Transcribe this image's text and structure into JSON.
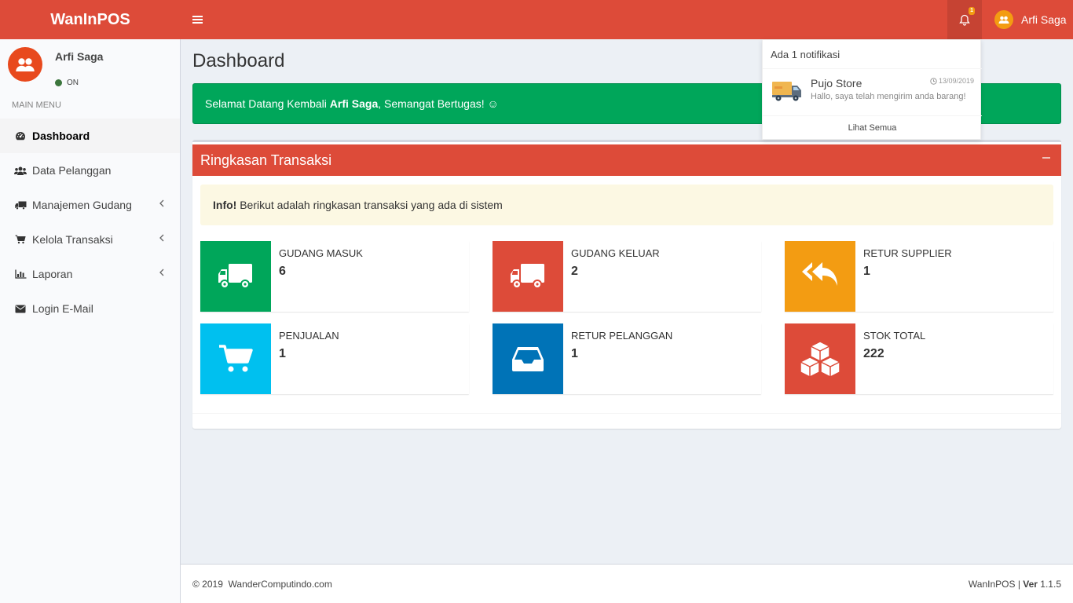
{
  "app": {
    "logo": "WanInPOS"
  },
  "header": {
    "notification_badge": "1",
    "user_name": "Arfi Saga"
  },
  "notifications": {
    "header": "Ada 1 notifikasi",
    "items": [
      {
        "from": "Pujo Store",
        "time": "13/09/2019",
        "message": "Hallo, saya telah mengirim anda barang!"
      }
    ],
    "footer": "Lihat Semua"
  },
  "sidebar": {
    "user_name": "Arfi Saga",
    "status": "ON",
    "menu_header": "MAIN MENU",
    "items": [
      {
        "label": "Dashboard",
        "icon": "dashboard-icon"
      },
      {
        "label": "Data Pelanggan",
        "icon": "users-icon"
      },
      {
        "label": "Manajemen Gudang",
        "icon": "truck-icon"
      },
      {
        "label": "Kelola Transaksi",
        "icon": "cart-icon"
      },
      {
        "label": "Laporan",
        "icon": "bar-chart-icon"
      },
      {
        "label": "Login E-Mail",
        "icon": "envelope-icon"
      }
    ]
  },
  "main": {
    "title": "Dashboard",
    "welcome": {
      "prefix": "Selamat Datang Kembali ",
      "name": "Arfi Saga",
      "suffix": ", Semangat Bertugas! ☺"
    },
    "box_title": "Ringkasan Transaksi",
    "callout": {
      "bold": "Info!",
      "text": " Berikut adalah ringkasan transaksi yang ada di sistem"
    },
    "stats": [
      {
        "label": "GUDANG MASUK",
        "value": "6",
        "color": "#00a65a",
        "icon": "truck-icon"
      },
      {
        "label": "GUDANG KELUAR",
        "value": "2",
        "color": "#dd4b39",
        "icon": "truck-icon"
      },
      {
        "label": "RETUR SUPPLIER",
        "value": "1",
        "color": "#f39c12",
        "icon": "reply-all-icon"
      },
      {
        "label": "PENJUALAN",
        "value": "1",
        "color": "#00c0ef",
        "icon": "cart-icon"
      },
      {
        "label": "RETUR PELANGGAN",
        "value": "1",
        "color": "#0073b7",
        "icon": "inbox-icon"
      },
      {
        "label": "STOK TOTAL",
        "value": "222",
        "color": "#dd4b39",
        "icon": "cubes-icon"
      }
    ]
  },
  "footer": {
    "copyright": "© 2019",
    "company": "WanderComputindo.com",
    "app_name": "WanInPOS | ",
    "ver_label": "Ver",
    "version": " 1.1.5"
  }
}
